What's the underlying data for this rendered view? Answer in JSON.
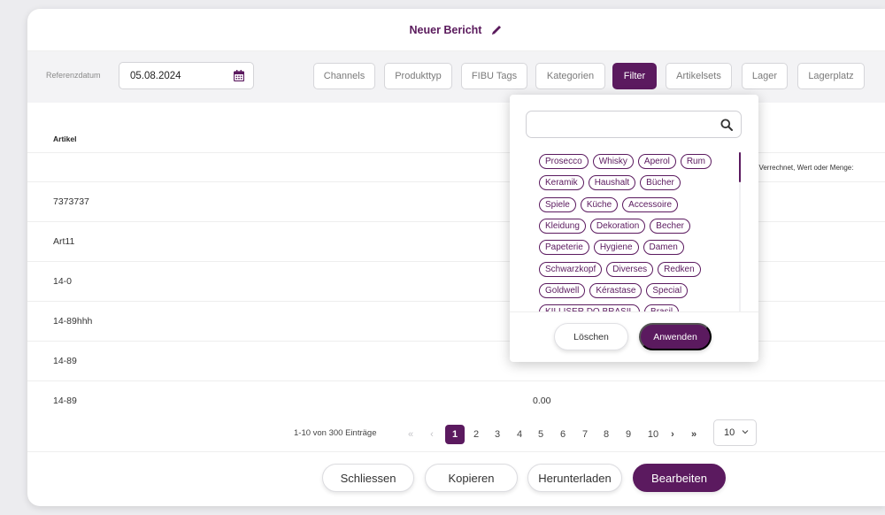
{
  "header": {
    "title": "Neuer Bericht",
    "edit_icon": "pencil-icon"
  },
  "toolbar": {
    "ref_label": "Referenzdatum",
    "date_value": "05.08.2024",
    "calendar_icon": "calendar-icon",
    "buttons": [
      "Channels",
      "Produkttyp",
      "FIBU Tags",
      "Kategorien",
      "Filter",
      "Artikelsets",
      "Lager",
      "Lagerplatz"
    ],
    "active_button": "Filter"
  },
  "table": {
    "column_artikel": "Artikel",
    "sub_note": ", Verrechnet, Wert oder Menge:",
    "rows": [
      {
        "artikel": "7373737",
        "value": ""
      },
      {
        "artikel": "Art11",
        "value": ""
      },
      {
        "artikel": "14-0",
        "value": ""
      },
      {
        "artikel": "14-89hhh",
        "value": ""
      },
      {
        "artikel": "14-89",
        "value": ""
      },
      {
        "artikel": "14-89",
        "value": "0.00"
      }
    ]
  },
  "pagination": {
    "summary": "1-10 von 300 Einträge",
    "first": "«",
    "prev": "‹",
    "pages": [
      "1",
      "2",
      "3",
      "4",
      "5",
      "6",
      "7",
      "8",
      "9",
      "10"
    ],
    "current_page": "1",
    "next": "›",
    "last": "»",
    "page_size": "10"
  },
  "footer": {
    "close": "Schliessen",
    "copy": "Kopieren",
    "download": "Herunterladen",
    "edit": "Bearbeiten"
  },
  "filter_popup": {
    "search_value": "",
    "search_icon": "search-icon",
    "tag_rows": [
      [
        "Prosecco",
        "Whisky",
        "Aperol",
        "Rum"
      ],
      [
        "Keramik",
        "Haushalt",
        "Bücher"
      ],
      [
        "Spiele",
        "Küche",
        "Accessoire"
      ],
      [
        "Kleidung",
        "Dekoration",
        "Becher"
      ],
      [
        "Papeterie",
        "Hygiene",
        "Damen"
      ],
      [
        "Schwarzkopf",
        "Diverses",
        "Redken"
      ],
      [
        "Goldwell",
        "Kérastase",
        "Special"
      ],
      [
        "KILLISER DO BRASIL",
        "Brasil"
      ]
    ],
    "clear_label": "Löschen",
    "apply_label": "Anwenden"
  },
  "colors": {
    "accent": "#5b1a5f",
    "background": "#ececef",
    "toolbar": "#f3f3f5"
  }
}
